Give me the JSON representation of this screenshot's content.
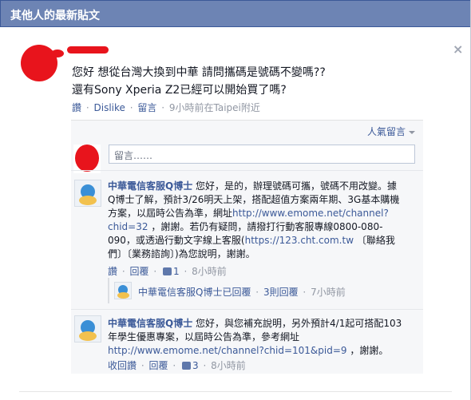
{
  "header": {
    "title": "其他人的最新貼文",
    "close_glyph": "×"
  },
  "post": {
    "line1": "您好 想從台灣大換到中華 請問攜碼是號碼不變嗎??",
    "line2": "還有Sony Xperia Z2已經可以開始買了嗎?",
    "actions": {
      "like": "讚",
      "dislike": "Dislike",
      "comment": "留言",
      "time": "9小時前在Taipei附近"
    }
  },
  "comments_panel": {
    "sort_label": "人氣留言",
    "input_placeholder": "留言……",
    "comment1": {
      "author": "中華電信客服Q博士",
      "text": "您好，是的，辦理號碼可攜，號碼不用改變。據Q博士了解，預計3/26明天上架，搭配超值方案兩年期、3G基本購機方案，以屆時公告為準，網址",
      "url": "http://www.emome.net/channel?chid=32",
      "text2": "，謝謝。若仍有疑問，請撥打行動客服專線0800-080-090，或透過行動文字線上客服(",
      "url2": "https://123.cht.com.tw",
      "text3": "〔聯絡我們〕〔業務諮詢〕)為您說明，謝謝。",
      "actions": {
        "like": "讚",
        "reply": "回覆",
        "likes": "1",
        "time": "8小時前"
      },
      "replies": {
        "author_text": "中華電信客服Q博士已回覆",
        "count": "3則回覆",
        "time": "7小時前"
      }
    },
    "comment2": {
      "author": "中華電信客服Q博士",
      "text": "您好，與您補充說明，另外預計4/1起可搭配103年學生優惠專案，以屆時公告為準，參考網址",
      "url": "http://www.emome.net/channel?chid=101&pid=9",
      "text2": "，謝謝。",
      "actions": {
        "unlike": "收回讚",
        "reply": "回覆",
        "likes": "3",
        "time": "8小時前"
      }
    }
  },
  "colors": {
    "header_bg": "#6d84b4",
    "link": "#3b5998",
    "meta": "#9197a3"
  }
}
